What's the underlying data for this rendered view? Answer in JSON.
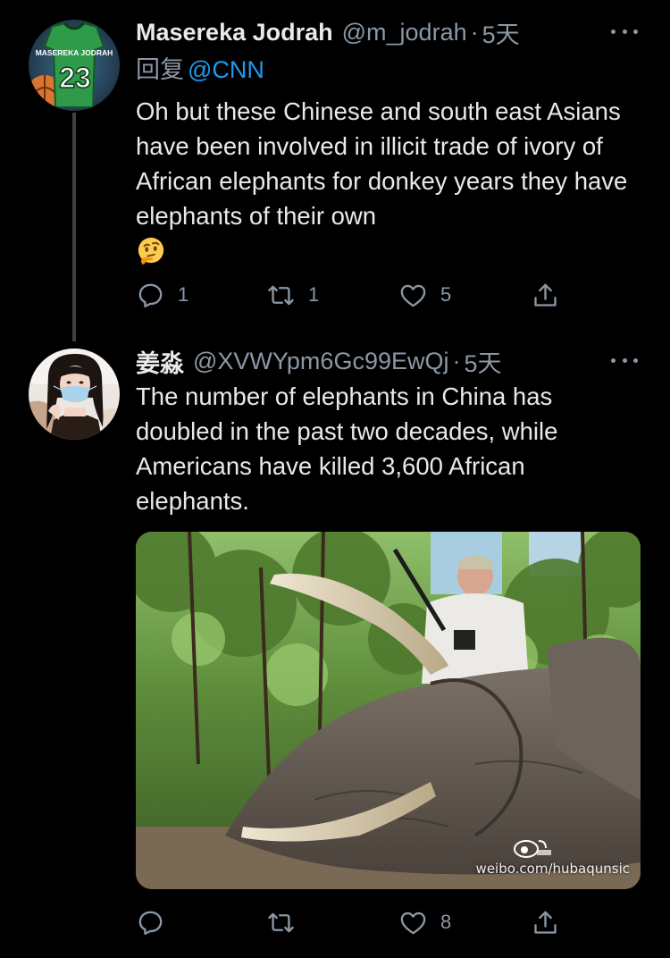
{
  "thread": [
    {
      "display_name": "Masereka Jodrah",
      "handle": "@m_jodrah",
      "separator": "·",
      "time": "5天",
      "reply_label": "回复",
      "reply_to": "@CNN",
      "avatar_jersey_name": "MASEREKA JODRAH",
      "avatar_jersey_number": "23",
      "text": "Oh but these Chinese and south east Asians have been involved in illicit trade of ivory of African elephants for donkey years they have elephants of their own",
      "emoji_name": "thinking-face",
      "reply_count": "1",
      "retweet_count": "1",
      "like_count": "5"
    },
    {
      "display_name": "姜淼",
      "handle": "@XVWYpm6Gc99EwQj",
      "separator": "·",
      "time": "5天",
      "text": "The number of elephants in China has doubled in the past two decades, while Americans have killed 3,600 African elephants.",
      "media_watermark": "weibo.com/hubaqunsic",
      "reply_count": "",
      "retweet_count": "",
      "like_count": "8"
    }
  ],
  "colors": {
    "background": "#000000",
    "primary_text": "#e7e9ea",
    "secondary_text": "#8b98a5",
    "link": "#1d9bf0",
    "thread_line": "#3d4146"
  },
  "icons": {
    "reply": "reply-icon",
    "retweet": "retweet-icon",
    "like": "heart-icon",
    "share": "share-icon",
    "more": "more-icon"
  }
}
